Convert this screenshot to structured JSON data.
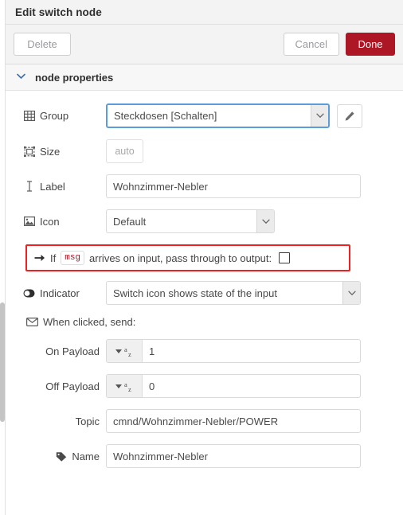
{
  "window": {
    "title": "Edit switch node"
  },
  "toolbar": {
    "delete_label": "Delete",
    "cancel_label": "Cancel",
    "done_label": "Done"
  },
  "section": {
    "title": "node properties",
    "chevron": "⌄"
  },
  "fields": {
    "group": {
      "label": "Group",
      "value": "Steckdosen [Schalten]",
      "icon": "table-icon",
      "edit_icon": "pencil-icon"
    },
    "size": {
      "label": "Size",
      "value": "auto",
      "icon": "object-group-icon"
    },
    "label": {
      "label": "Label",
      "value": "Wohnzimmer-Nebler",
      "icon": "text-cursor-icon"
    },
    "icon": {
      "label": "Icon",
      "value": "Default",
      "icon": "image-icon"
    },
    "passthrough": {
      "arrow_icon": "arrow-right-icon",
      "text_before": "If",
      "chip": "msg",
      "text_after": "arrives on input, pass through to output:",
      "checked": false
    },
    "indicator": {
      "label": "Indicator",
      "value": "Switch icon shows state of the input",
      "icon": "toggle-on-icon"
    },
    "when_clicked": {
      "label": "When clicked, send:",
      "icon": "envelope-icon"
    },
    "on_payload": {
      "label": "On Payload",
      "value": "1",
      "type_icon": "az-string-icon"
    },
    "off_payload": {
      "label": "Off Payload",
      "value": "0",
      "type_icon": "az-string-icon"
    },
    "topic": {
      "label": "Topic",
      "value": "cmnd/Wohnzimmer-Nebler/POWER"
    },
    "name": {
      "label": "Name",
      "value": "Wohnzimmer-Nebler",
      "icon": "tag-icon"
    }
  },
  "colors": {
    "done_red": "#ad1625",
    "highlight_red": "#ee2020",
    "focus_blue": "#5b9dd9",
    "chip_red": "#ad1625"
  }
}
